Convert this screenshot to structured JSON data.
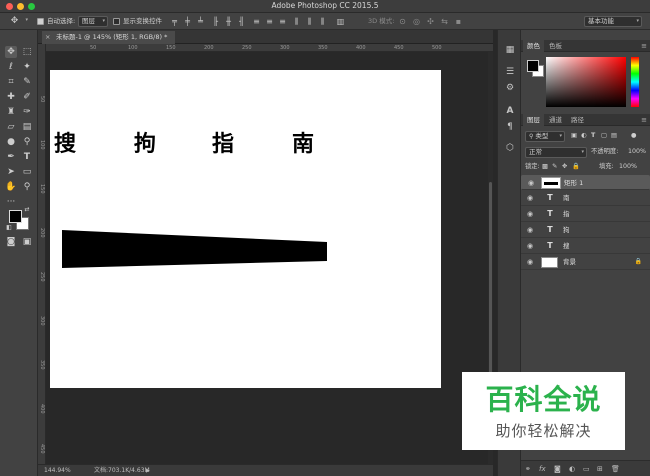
{
  "window": {
    "title": "Adobe Photoshop CC 2015.5"
  },
  "options": {
    "auto_select_label": "自动选择:",
    "auto_select_value": "图层",
    "show_transform_label": "显示变换控件",
    "mode_3d_label": "3D 模式:",
    "workspace_value": "基本功能"
  },
  "document": {
    "tab_label": "未标题-1 @ 145% (矩形 1, RGB/8) *",
    "ruler_top": [
      "50",
      "100",
      "150",
      "200",
      "250",
      "300",
      "350",
      "400",
      "450",
      "500"
    ],
    "ruler_left": [
      "50",
      "100",
      "150",
      "200",
      "250",
      "300",
      "350",
      "400",
      "450"
    ],
    "glyphs": [
      "搜",
      "拘",
      "指",
      "南"
    ]
  },
  "status": {
    "zoom": "144.94%",
    "doc_size": "文档:703.1K/4.63M"
  },
  "color_panel": {
    "tabs": [
      "颜色",
      "色板"
    ]
  },
  "layers_panel": {
    "tabs": [
      "图层",
      "通道",
      "路径"
    ],
    "filter_label": "类型",
    "blend_mode": "正常",
    "opacity_label": "不透明度:",
    "opacity_value": "100%",
    "lock_label": "锁定:",
    "fill_label": "填充:",
    "fill_value": "100%",
    "layers": [
      {
        "name": "矩形 1",
        "kind": "shape",
        "selected": true
      },
      {
        "name": "南",
        "kind": "text"
      },
      {
        "name": "指",
        "kind": "text"
      },
      {
        "name": "狗",
        "kind": "text"
      },
      {
        "name": "搜",
        "kind": "text"
      },
      {
        "name": "背景",
        "kind": "background"
      }
    ],
    "bottom_icons": [
      "link-icon",
      "fx-icon",
      "mask-icon",
      "adjustment-icon",
      "group-icon",
      "new-layer-icon",
      "trash-icon"
    ]
  },
  "watermark": {
    "title": "百科全说",
    "subtitle": "助你轻松解决"
  },
  "colors": {
    "foreground": "#000000",
    "background": "#ffffff",
    "watermark_green": "#2bb24c"
  }
}
